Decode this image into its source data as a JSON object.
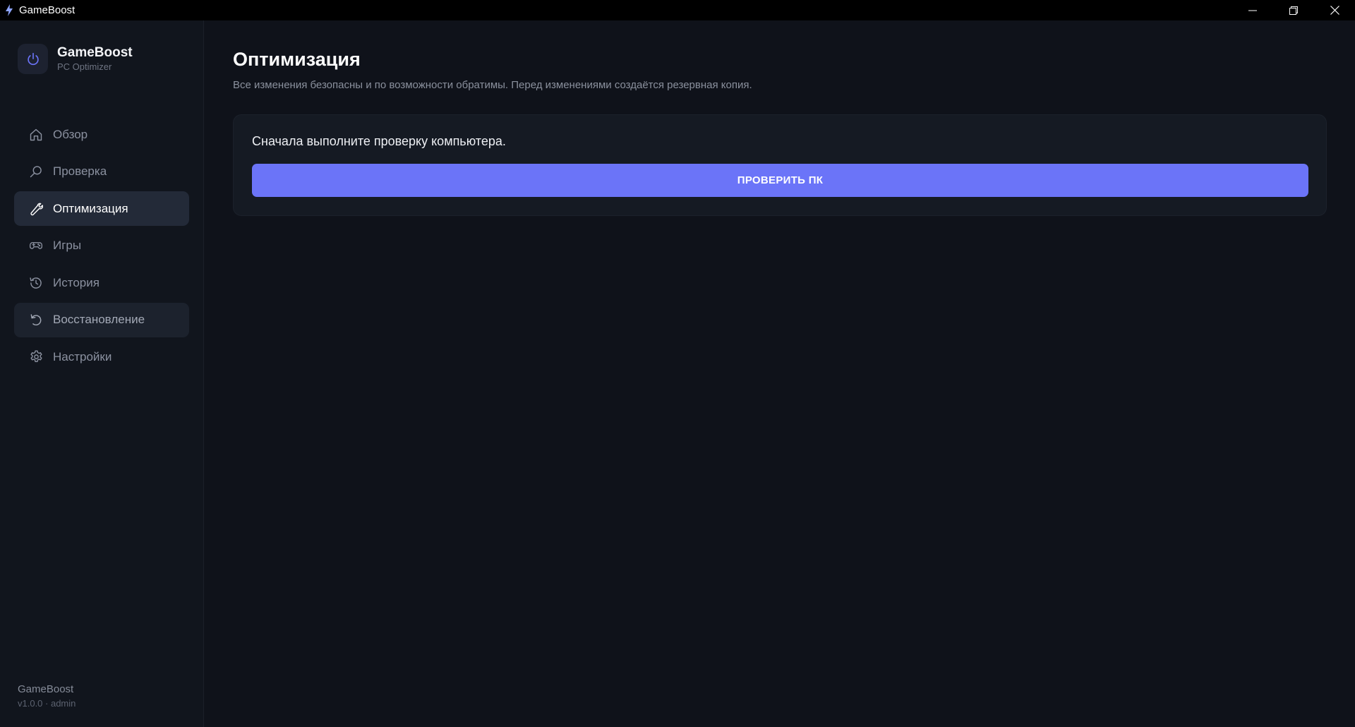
{
  "window": {
    "title": "GameBoost"
  },
  "brand": {
    "name": "GameBoost",
    "subtitle": "PC Optimizer"
  },
  "sidebar": {
    "items": [
      {
        "label": "Обзор",
        "icon": "home-icon"
      },
      {
        "label": "Проверка",
        "icon": "search-icon"
      },
      {
        "label": "Оптимизация",
        "icon": "wrench-icon",
        "state": "active"
      },
      {
        "label": "Игры",
        "icon": "gamepad-icon"
      },
      {
        "label": "История",
        "icon": "history-icon"
      },
      {
        "label": "Восстановление",
        "icon": "undo-icon",
        "state": "hover"
      },
      {
        "label": "Настройки",
        "icon": "gear-icon"
      }
    ]
  },
  "footer": {
    "name": "GameBoost",
    "version": "v1.0.0 · admin"
  },
  "page": {
    "title": "Оптимизация",
    "subtitle": "Все изменения безопасны и по возможности обратимы. Перед изменениями создаётся резервная копия."
  },
  "card": {
    "message": "Сначала выполните проверку компьютера.",
    "button_label": "ПРОВЕРИТЬ ПК"
  },
  "colors": {
    "accent": "#6b74f8",
    "background": "#0f121a",
    "sidebar": "#11151d",
    "card": "#151a23",
    "nav_active": "#232a38"
  }
}
